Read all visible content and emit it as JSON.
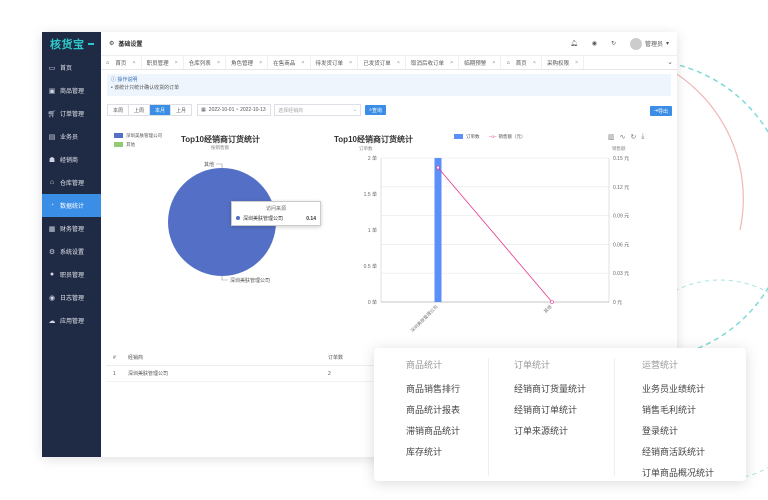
{
  "app": {
    "logo": "核货宝"
  },
  "sidebar": {
    "items": [
      {
        "label": "首页",
        "icon": "monitor-icon"
      },
      {
        "label": "商品管理",
        "icon": "box-icon"
      },
      {
        "label": "订单管理",
        "icon": "cart-icon"
      },
      {
        "label": "业务员",
        "icon": "briefcase-icon"
      },
      {
        "label": "经销商",
        "icon": "people-icon"
      },
      {
        "label": "仓库管理",
        "icon": "warehouse-icon"
      },
      {
        "label": "数据统计",
        "icon": "stats-icon",
        "active": true
      },
      {
        "label": "财务管理",
        "icon": "finance-icon"
      },
      {
        "label": "系统设置",
        "icon": "gear-icon"
      },
      {
        "label": "职员管理",
        "icon": "user-icon"
      },
      {
        "label": "日志管理",
        "icon": "eye-icon"
      },
      {
        "label": "应用管理",
        "icon": "cloud-icon"
      }
    ]
  },
  "topbar": {
    "title": "基础设置",
    "user": "管理员"
  },
  "tabs": [
    "首页",
    "职员管理",
    "仓库列表",
    "角色管理",
    "在售商品",
    "待发货订单",
    "已发货订单",
    "取消后收订单",
    "临期预警",
    "首页",
    "采购权限"
  ],
  "notice": {
    "title": "操作说明",
    "text": "• 该统计只统计确认收货的订单"
  },
  "filters": {
    "periods": [
      "本周",
      "上周",
      "本月",
      "上月"
    ],
    "active_period": "本月",
    "date_range": "2022-10-01 ~ 2022-10-13",
    "select_placeholder": "选择经销商",
    "query_label": "查询",
    "export_label": "导出"
  },
  "pie": {
    "title": "Top10经销商订货统计",
    "subtitle": "按销售额",
    "legend": [
      {
        "name": "深圳美肤管理公司",
        "color": "#5470c6"
      },
      {
        "name": "其他",
        "color": "#91cc75"
      }
    ],
    "label_top": "其他",
    "label_bottom": "深圳美肤管理公司",
    "tooltip": {
      "title": "访问来源",
      "name": "深圳美肤管理公司",
      "value": "0.14"
    }
  },
  "bar": {
    "title": "Top10经销商订货统计",
    "legend_bar": "订单数",
    "legend_line": "销售额（元）",
    "left_axis_title": "订单数",
    "right_axis_title": "销售额"
  },
  "chart_data": [
    {
      "type": "pie",
      "title": "Top10经销商订货统计",
      "subtitle": "按销售额",
      "categories": [
        "深圳美肤管理公司",
        "其他"
      ],
      "values": [
        0.14,
        0
      ]
    },
    {
      "type": "bar",
      "title": "Top10经销商订货统计",
      "categories": [
        "深圳美肤管理公司",
        "其他"
      ],
      "series": [
        {
          "name": "订单数",
          "type": "bar",
          "values": [
            2,
            0
          ],
          "axis": "left"
        },
        {
          "name": "销售额（元）",
          "type": "line",
          "values": [
            0.14,
            0
          ],
          "axis": "right"
        }
      ],
      "left_ticks": [
        "0 单",
        "0.5 单",
        "1 单",
        "1.5 单",
        "2 单"
      ],
      "right_ticks": [
        "0 元",
        "0.03 元",
        "0.06 元",
        "0.09 元",
        "0.12 元",
        "0.15 元"
      ],
      "ylim_left": [
        0,
        2
      ],
      "ylim_right": [
        0,
        0.15
      ],
      "colors": {
        "bar": "#5b8ff9",
        "line": "#e8368f"
      }
    }
  ],
  "table": {
    "headers": [
      "#",
      "经销商",
      "订单数"
    ],
    "rows": [
      [
        "1",
        "深圳美肤管理公司",
        "2"
      ]
    ]
  },
  "popup": {
    "columns": [
      {
        "title": "商品统计",
        "links": [
          "商品销售排行",
          "商品统计报表",
          "滞销商品统计",
          "库存统计"
        ]
      },
      {
        "title": "订单统计",
        "links": [
          "经销商订货量统计",
          "经销商订单统计",
          "订单来源统计"
        ]
      },
      {
        "title": "运营统计",
        "links": [
          "业务员业绩统计",
          "销售毛利统计",
          "登录统计",
          "经销商活跃统计",
          "订单商品概况统计"
        ]
      }
    ]
  }
}
